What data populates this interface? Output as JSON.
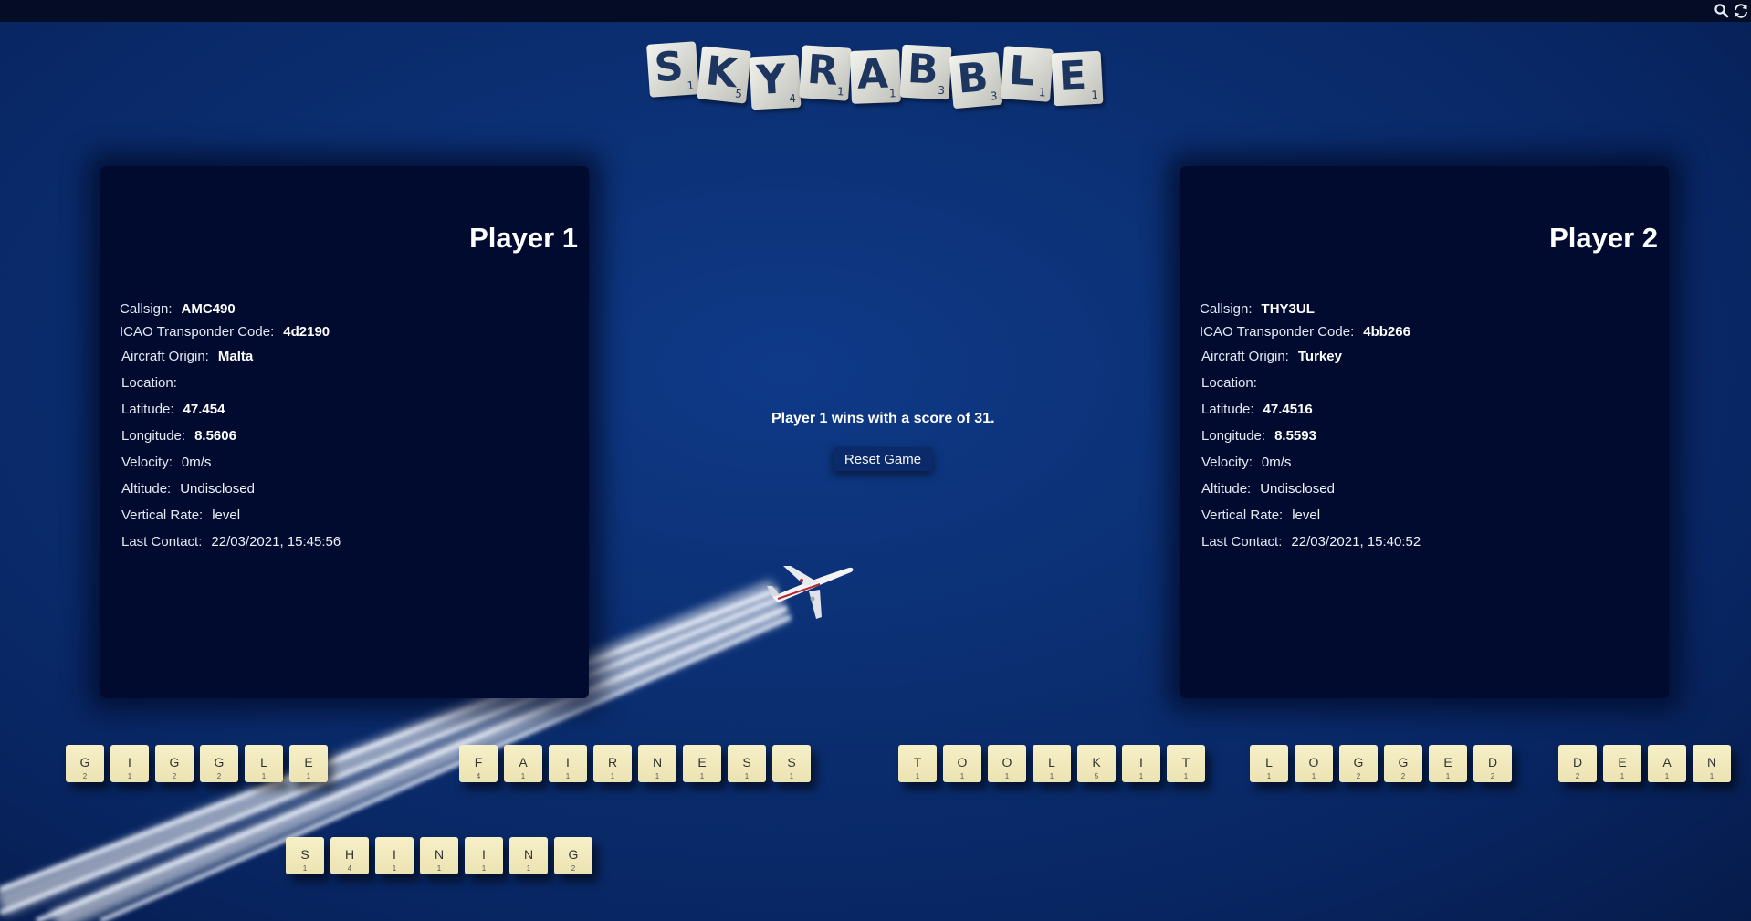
{
  "topbar": {
    "icons": [
      "search-icon",
      "refresh-icon"
    ]
  },
  "logo": {
    "tiles": [
      {
        "ch": "S",
        "pt": "1"
      },
      {
        "ch": "K",
        "pt": "5"
      },
      {
        "ch": "Y",
        "pt": "4"
      },
      {
        "ch": "R",
        "pt": "1"
      },
      {
        "ch": "A",
        "pt": "1"
      },
      {
        "ch": "B",
        "pt": "3"
      },
      {
        "ch": "B",
        "pt": "3"
      },
      {
        "ch": "L",
        "pt": "1"
      },
      {
        "ch": "E",
        "pt": "1"
      }
    ]
  },
  "player1": {
    "title": "Player 1",
    "callsign_label": "Callsign:",
    "callsign": "AMC490",
    "icao_label": "ICAO Transponder Code:",
    "icao": "4d2190",
    "origin_label": "Aircraft Origin:",
    "origin": "Malta",
    "location_label": "Location:",
    "lat_label": "Latitude:",
    "lat": "47.454",
    "lon_label": "Longitude:",
    "lon": "8.5606",
    "vel_label": "Velocity:",
    "vel": "0m/s",
    "alt_label": "Altitude:",
    "alt": "Undisclosed",
    "vr_label": "Vertical Rate:",
    "vr": "level",
    "lc_label": "Last Contact:",
    "lc": "22/03/2021, 15:45:56"
  },
  "player2": {
    "title": "Player 2",
    "callsign_label": "Callsign:",
    "callsign": "THY3UL",
    "icao_label": "ICAO Transponder Code:",
    "icao": "4bb266",
    "origin_label": "Aircraft Origin:",
    "origin": "Turkey",
    "location_label": "Location:",
    "lat_label": "Latitude:",
    "lat": "47.4516",
    "lon_label": "Longitude:",
    "lon": "8.5593",
    "vel_label": "Velocity:",
    "vel": "0m/s",
    "alt_label": "Altitude:",
    "alt": "Undisclosed",
    "vr_label": "Vertical Rate:",
    "vr": "level",
    "lc_label": "Last Contact:",
    "lc": "22/03/2021, 15:40:52"
  },
  "game": {
    "result": "Player 1 wins with a score of 31.",
    "reset_label": "Reset Game"
  },
  "words": [
    {
      "name": "GIGGLE",
      "tiles": [
        [
          "G",
          "2"
        ],
        [
          "I",
          "1"
        ],
        [
          "G",
          "2"
        ],
        [
          "G",
          "2"
        ],
        [
          "L",
          "1"
        ],
        [
          "E",
          "1"
        ]
      ]
    },
    {
      "name": "FAIRNESS",
      "tiles": [
        [
          "F",
          "4"
        ],
        [
          "A",
          "1"
        ],
        [
          "I",
          "1"
        ],
        [
          "R",
          "1"
        ],
        [
          "N",
          "1"
        ],
        [
          "E",
          "1"
        ],
        [
          "S",
          "1"
        ],
        [
          "S",
          "1"
        ]
      ]
    },
    {
      "name": "TOOLKIT",
      "tiles": [
        [
          "T",
          "1"
        ],
        [
          "O",
          "1"
        ],
        [
          "O",
          "1"
        ],
        [
          "L",
          "1"
        ],
        [
          "K",
          "5"
        ],
        [
          "I",
          "1"
        ],
        [
          "T",
          "1"
        ]
      ]
    },
    {
      "name": "LOGGED",
      "tiles": [
        [
          "L",
          "1"
        ],
        [
          "O",
          "1"
        ],
        [
          "G",
          "2"
        ],
        [
          "G",
          "2"
        ],
        [
          "E",
          "1"
        ],
        [
          "D",
          "2"
        ]
      ]
    },
    {
      "name": "DEAN",
      "tiles": [
        [
          "D",
          "2"
        ],
        [
          "E",
          "1"
        ],
        [
          "A",
          "1"
        ],
        [
          "N",
          "1"
        ]
      ]
    },
    {
      "name": "SHINING",
      "tiles": [
        [
          "S",
          "1"
        ],
        [
          "H",
          "4"
        ],
        [
          "I",
          "1"
        ],
        [
          "N",
          "1"
        ],
        [
          "I",
          "1"
        ],
        [
          "N",
          "1"
        ],
        [
          "G",
          "2"
        ]
      ]
    }
  ]
}
